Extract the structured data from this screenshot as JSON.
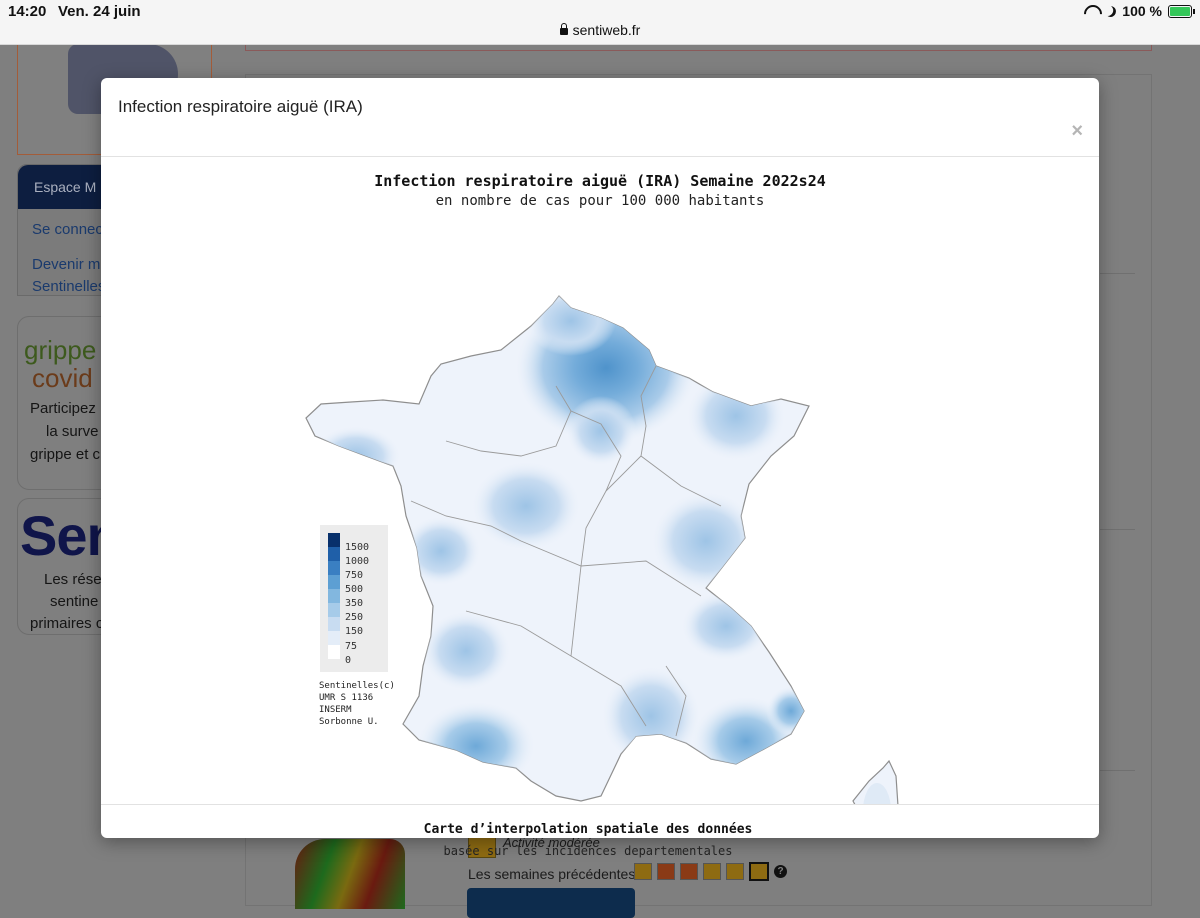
{
  "status": {
    "time": "14:20",
    "date": "Ven. 24 juin",
    "url": "sentiweb.fr",
    "battery": "100 %"
  },
  "background": {
    "espace_header": "Espace M",
    "espace_link1": "Se connec",
    "espace_link2a": "Devenir m",
    "espace_link2b": "Sentinelles",
    "grippe_line1": "grippe",
    "grippe_line2": "covid",
    "grippe_text": [
      "Participez",
      "la surve",
      "grippe et c"
    ],
    "senti_big": "Sen",
    "senti_text": [
      "Les rése",
      "sentine",
      "primaires c"
    ],
    "activity_label": "Activité modérée",
    "previous_weeks_label": "Les semaines précédentes",
    "help_icon": "?",
    "week_colors": [
      "#8e6b12",
      "#8a3a16",
      "#8a3a16",
      "#8e6b12",
      "#8e6b12",
      "#8e6b12"
    ]
  },
  "modal": {
    "title": "Infection respiratoire aiguë (IRA)",
    "close": "×",
    "map": {
      "title": "Infection respiratoire aiguë (IRA) Semaine 2022s24",
      "subtitle": "en nombre de cas pour 100 000 habitants",
      "caption": "Carte d’interpolation spatiale des données",
      "caption_sub": "basée sur les incidences departementales",
      "credit": [
        "Sentinelles(c)",
        "UMR S 1136",
        "INSERM",
        "Sorbonne U."
      ],
      "legend": [
        {
          "label": "1500",
          "color": "#08306b"
        },
        {
          "label": "1000",
          "color": "#1f5fa8"
        },
        {
          "label": "750",
          "color": "#3a7fc2"
        },
        {
          "label": "500",
          "color": "#5d9fd3"
        },
        {
          "label": "350",
          "color": "#82b7df"
        },
        {
          "label": "250",
          "color": "#a6cbe9"
        },
        {
          "label": "150",
          "color": "#c8dcf1"
        },
        {
          "label": "75",
          "color": "#e4edf8"
        },
        {
          "label": "0",
          "color": "#ffffff"
        }
      ]
    }
  }
}
